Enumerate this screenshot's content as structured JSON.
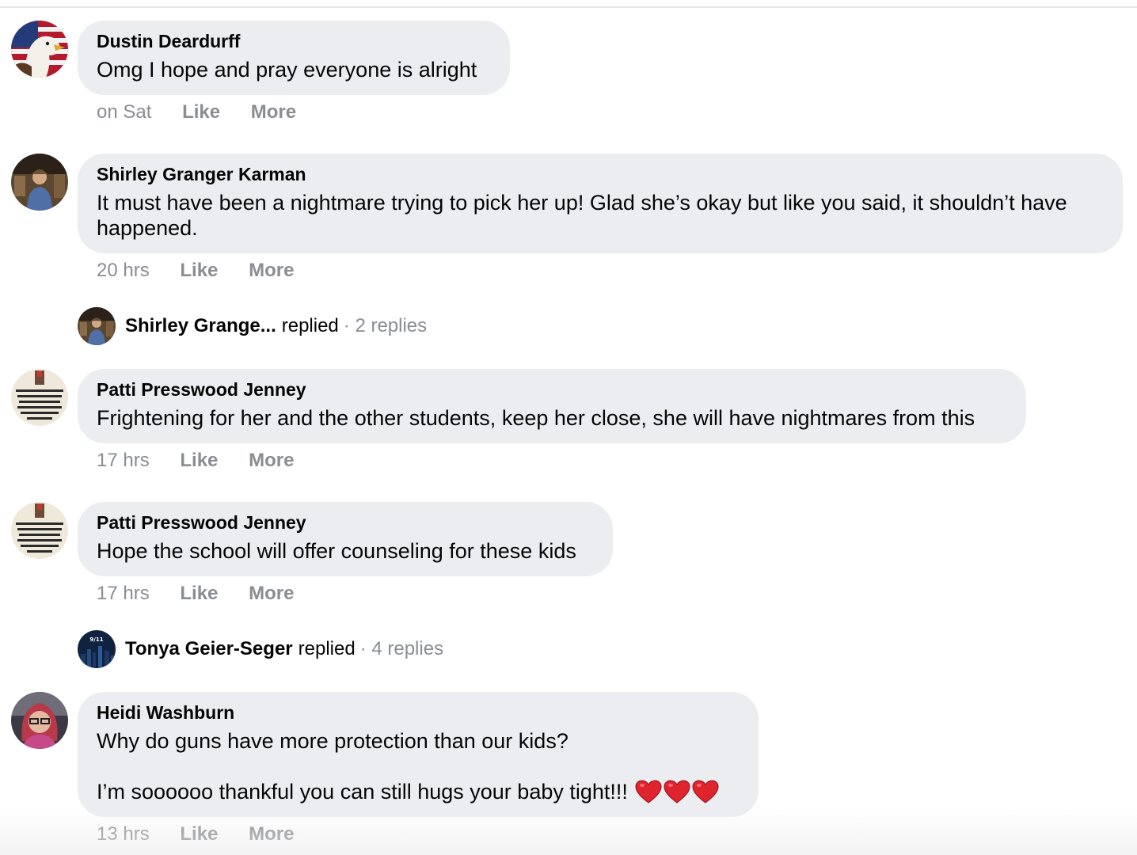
{
  "comments": [
    {
      "author": "Dustin Deardurff",
      "text": "Omg I hope and pray everyone is alright",
      "time": "on Sat",
      "like": "Like",
      "more": "More",
      "avatar": "eagle-flag-avatar"
    },
    {
      "author": "Shirley Granger Karman",
      "text": "It must have been a nightmare trying to pick her up! Glad she’s okay but like you said, it shouldn’t have happened.",
      "time": "20 hrs",
      "like": "Like",
      "more": "More",
      "avatar": "person-photo-avatar"
    },
    {
      "author": "Patti Presswood Jenney",
      "text": "Frightening for her and the other students, keep her close, she will have nightmares from this",
      "time": "17 hrs",
      "like": "Like",
      "more": "More",
      "avatar": "quote-text-avatar"
    },
    {
      "author": "Patti Presswood Jenney",
      "text": "Hope the school will offer counseling for these kids",
      "time": "17 hrs",
      "like": "Like",
      "more": "More",
      "avatar": "quote-text-avatar"
    },
    {
      "author": "Heidi Washburn",
      "text_line1": "Why do guns have more protection than our kids?",
      "text_line2": "I’m soooooo thankful you can still hugs your baby tight!!!",
      "emoji": "red-heart x3",
      "time": "13 hrs",
      "like": "Like",
      "more": "More",
      "avatar": "woman-red-hair-avatar"
    }
  ],
  "reply_threads": [
    {
      "name": "Shirley Grange...",
      "verb": "replied",
      "count": "· 2 replies"
    },
    {
      "name": "Tonya Geier-Seger",
      "verb": "replied",
      "count": "· 4 replies",
      "avatar_text": "9/11"
    }
  ],
  "colors": {
    "bubble": "#ebedf0",
    "meta_text": "#8a8d91",
    "primary_text": "#050505",
    "heart": "#e0242e"
  }
}
